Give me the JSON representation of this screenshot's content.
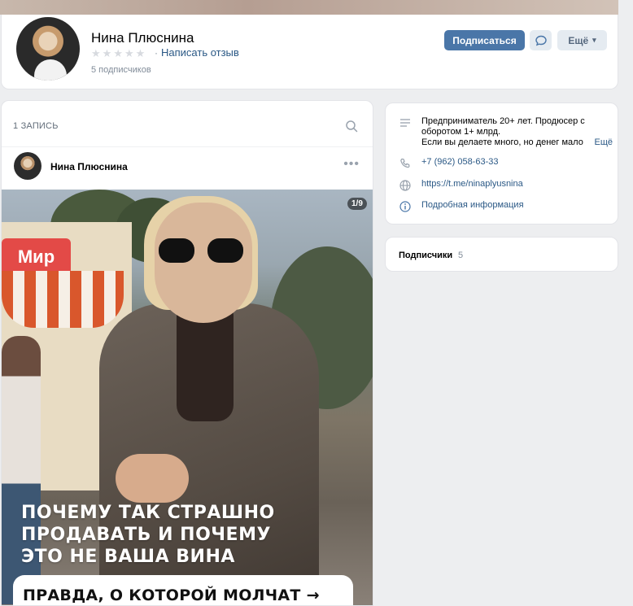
{
  "profile": {
    "name": "Нина Плюснина",
    "rating_link": "Написать отзыв",
    "rating_sep": "·",
    "subscribers_text": "5 подписчиков",
    "subscribe_button": "Подписаться",
    "more_button": "Ещё"
  },
  "wall": {
    "header": "1 ЗАПИСЬ",
    "post": {
      "author": "Нина Плюснина",
      "counter": "1/9",
      "overlay_line1": "ПОЧЕМУ ТАК СТРАШНО",
      "overlay_line2": "ПРОДАВАТЬ И ПОЧЕМУ",
      "overlay_line3": "ЭТО НЕ ВАША ВИНА",
      "overlay_button": "ПРАВДА, О КОТОРОЙ МОЛЧАТ →",
      "kiosk_sign": "Мир"
    }
  },
  "info": {
    "description_line1": "Предприниматель 20+ лет. Продюсер с",
    "description_line2": "оборотом 1+ млрд.",
    "description_line3": "Если вы делаете много, но денег мало",
    "description_more": "Ещё",
    "phone": "+7 (962) 058-63-33",
    "link": "https://t.me/ninaplyusnina",
    "details": "Подробная информация"
  },
  "subscribers": {
    "label": "Подписчики",
    "count": "5"
  },
  "colors": {
    "accent": "#4a76a8",
    "link": "#2a5885",
    "secondary_button": "#e5ebf1"
  }
}
